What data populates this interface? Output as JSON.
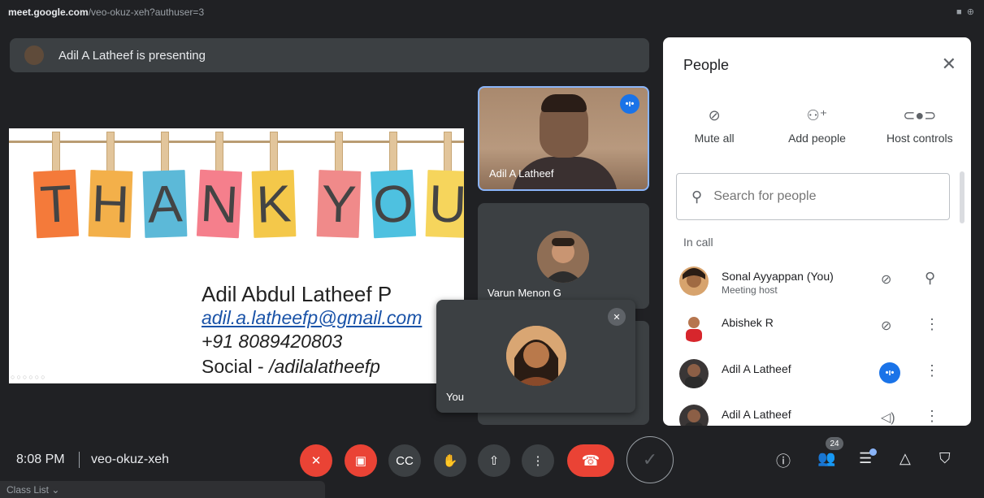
{
  "browser": {
    "domain": "meet.google.com",
    "path": "/veo-okuz-xeh?authuser=3"
  },
  "banner": {
    "text": "Adil A Latheef is presenting"
  },
  "slide": {
    "letters": [
      "T",
      "H",
      "A",
      "N",
      "K",
      "Y",
      "O",
      "U"
    ],
    "card_colors": [
      "#f47a3a",
      "#f3b04a",
      "#5cb9d8",
      "#f57f8c",
      "#f4c84a",
      "#f08a8a",
      "#4ec1e0",
      "#f6d55c"
    ],
    "name": "Adil Abdul Latheef P",
    "email": "adil.a.latheefp@gmail.com",
    "phone": "+91 8089420803",
    "social_prefix": "Social - ",
    "social_handle": "/adilalatheefp"
  },
  "tiles": {
    "main": {
      "label": "Adil A Latheef"
    },
    "second": {
      "label": "Varun Menon G"
    },
    "self": {
      "label": "You"
    }
  },
  "people_panel": {
    "title": "People",
    "actions": [
      {
        "label": "Mute all",
        "icon": "mic-off-icon"
      },
      {
        "label": "Add people",
        "icon": "add-person-icon"
      },
      {
        "label": "Host controls",
        "icon": "toggle-icon"
      }
    ],
    "search_placeholder": "Search for people",
    "section": "In call",
    "people": [
      {
        "name": "Sonal Ayyappan (You)",
        "sub": "Meeting host"
      },
      {
        "name": "Abishek R",
        "sub": ""
      },
      {
        "name": "Adil A Latheef",
        "sub": ""
      },
      {
        "name": "Adil A Latheef",
        "sub": ""
      }
    ]
  },
  "bottom": {
    "time": "8:08 PM",
    "meeting_code": "veo-okuz-xeh",
    "participant_count": "24"
  },
  "taskbar": {
    "label": "Class List"
  }
}
